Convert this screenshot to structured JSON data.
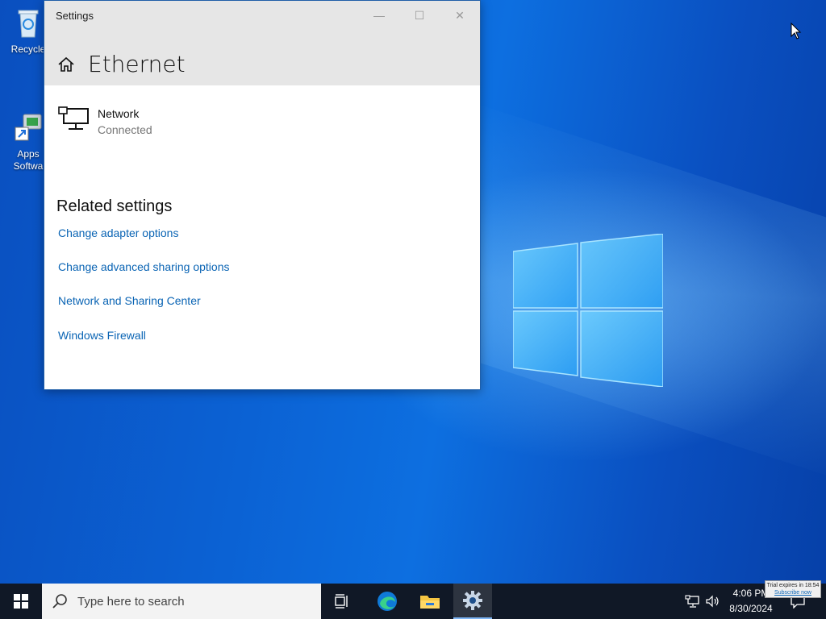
{
  "desktop": {
    "icons": [
      {
        "label": "Recycle",
        "icon": "recycle-bin-icon"
      },
      {
        "label": "Apps Softwa",
        "icon": "apps-software-icon"
      }
    ]
  },
  "window": {
    "title": "Settings",
    "controls": {
      "minimize": "—",
      "maximize": "☐",
      "close": "✕"
    },
    "heading": "Ethernet",
    "network": {
      "name": "Network",
      "status": "Connected"
    },
    "related": {
      "title": "Related settings",
      "links": [
        "Change adapter options",
        "Change advanced sharing options",
        "Network and Sharing Center",
        "Windows Firewall"
      ]
    }
  },
  "taskbar": {
    "search_placeholder": "Type here to search",
    "clock": {
      "time": "4:06 PM",
      "date": "8/30/2024"
    },
    "trial": {
      "text": "Trial expires in 18:54",
      "link": "Subscribe now"
    }
  },
  "colors": {
    "link": "#0a64b4",
    "taskbar": "#101826",
    "header_bg": "#e6e6e6"
  }
}
